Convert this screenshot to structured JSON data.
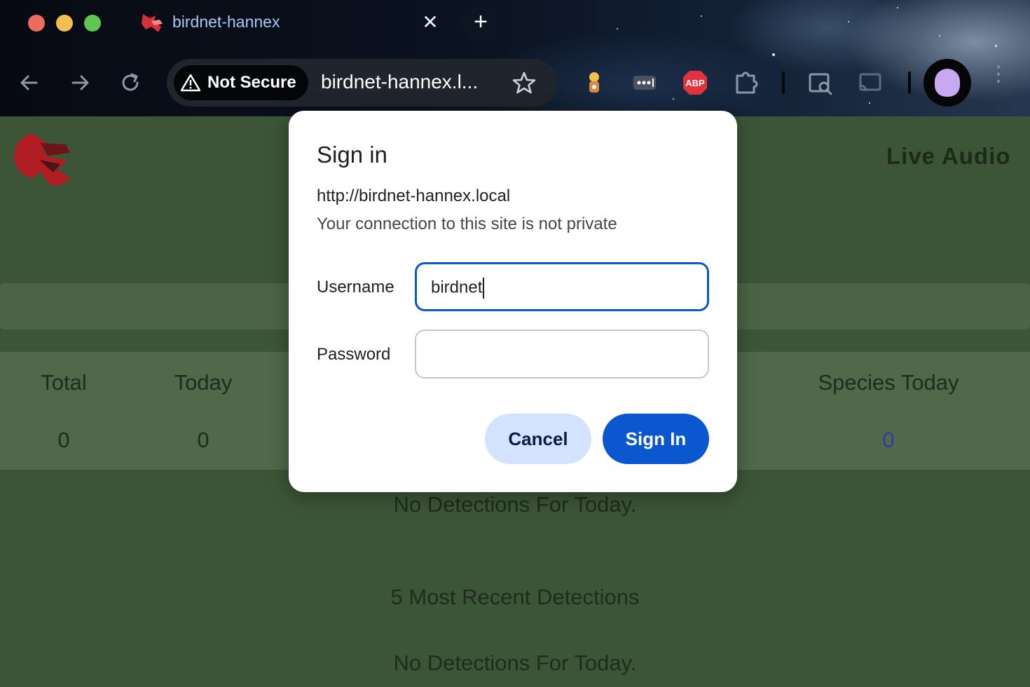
{
  "browser": {
    "tab": {
      "title": "birdnet-hannex",
      "close_label": "✕"
    },
    "new_tab_label": "+",
    "security_chip": "Not Secure",
    "url": "birdnet-hannex.l...",
    "extensions": [
      "grafana-extension-icon",
      "password-manager-icon",
      "adblock-plus-icon",
      "puzzle-extensions-icon",
      "search-inspect-icon",
      "cast-icon"
    ],
    "adblock_label": "ABP"
  },
  "page": {
    "header_link": "Live Audio",
    "stats": {
      "headers": [
        "Total",
        "Today",
        "Species Today"
      ],
      "values": [
        "0",
        "0",
        "0"
      ]
    },
    "today_message": "No Detections For Today.",
    "recent_heading": "5 Most Recent Detections",
    "recent_message": "No Detections For Today."
  },
  "dialog": {
    "title": "Sign in",
    "origin": "http://birdnet-hannex.local",
    "note": "Your connection to this site is not private",
    "username_label": "Username",
    "username_value": "birdnet",
    "password_label": "Password",
    "password_value": "",
    "cancel_label": "Cancel",
    "signin_label": "Sign In"
  },
  "colors": {
    "accent": "#0b57d0",
    "page_bg": "#3d5537",
    "stat_blue": "#2a3fa0"
  }
}
